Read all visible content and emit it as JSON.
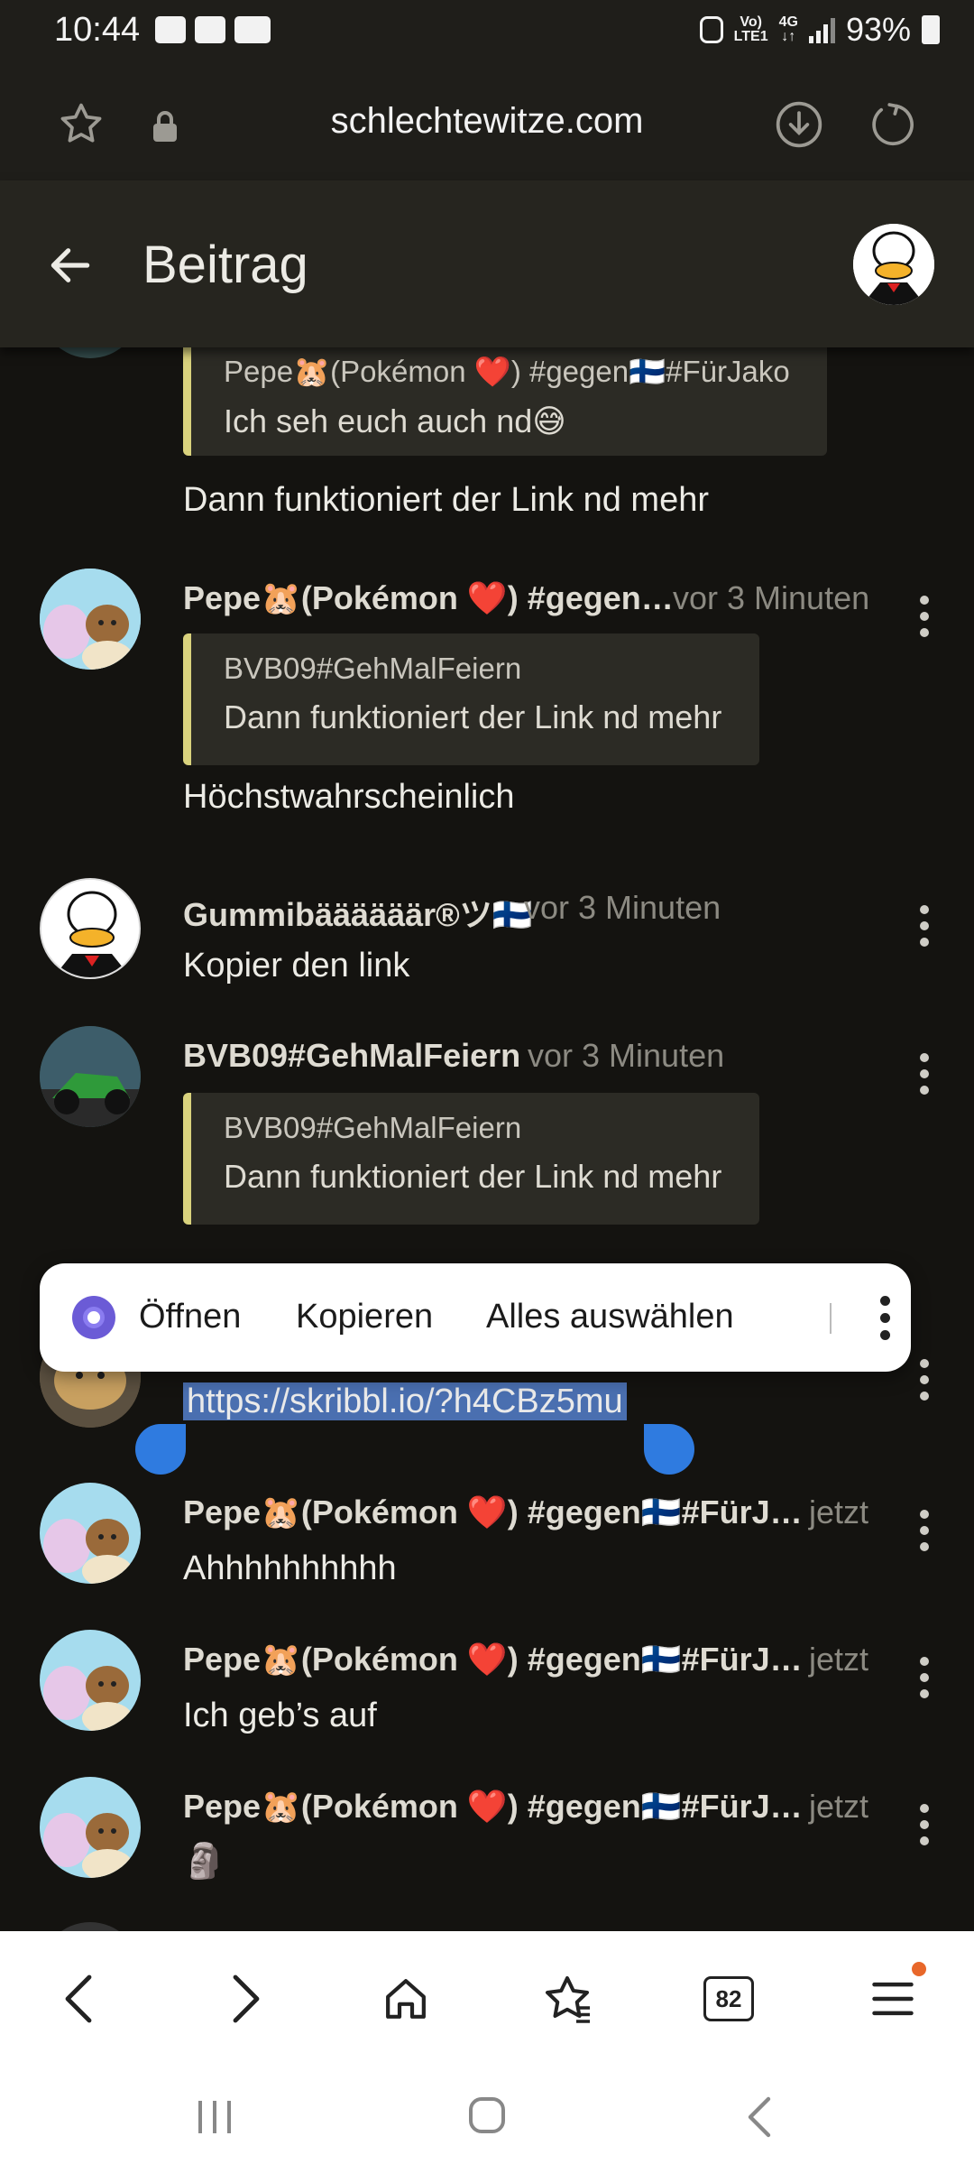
{
  "status_bar": {
    "time": "10:44",
    "network_top": "Vo)",
    "network_bottom": "LTE1",
    "network_gen": "4G",
    "battery": "93%"
  },
  "url_bar": {
    "domain": "schlechtewitze.com",
    "icons": [
      "star-outline-icon",
      "lock-icon",
      "download-icon",
      "reload-icon"
    ]
  },
  "header": {
    "title": "Beitrag"
  },
  "feed": {
    "partial": {
      "quote_author": "Pepe🐹(Pokémon ❤️) #gegen🇫🇮#FürJako",
      "quote_text": "Ich seh euch auch nd😅",
      "message": "Dann funktioniert der Link nd mehr"
    },
    "posts": [
      {
        "author": "Pepe🐹(Pokémon ❤️) #gegen…",
        "time": "vor 3 Minuten",
        "quote_author": "BVB09#GehMalFeiern",
        "quote_text": "Dann funktioniert der Link nd mehr",
        "message": "Höchstwahrscheinlich"
      },
      {
        "author": "Gummibäääääär®ツ🇫🇮",
        "time": "vor 3 Minuten",
        "message": "Kopier den link"
      },
      {
        "author": "BVB09#GehMalFeiern",
        "time": "vor 3 Minuten",
        "quote_author": "BVB09#GehMalFeiern",
        "quote_text": "Dann funktioniert der Link nd mehr"
      },
      {
        "author": "",
        "message": "https://skribbl.io/?h4CBz5mu"
      },
      {
        "author": "Pepe🐹(Pokémon ❤️) #gegen🇫🇮#FürJ…",
        "time": "jetzt",
        "message": "Ahhhhhhhhhh"
      },
      {
        "author": "Pepe🐹(Pokémon ❤️) #gegen🇫🇮#FürJ…",
        "time": "jetzt",
        "message": "Ich geb’s auf"
      },
      {
        "author": "Pepe🐹(Pokémon ❤️) #gegen🇫🇮#FürJ…",
        "time": "jetzt",
        "message": "🗿"
      }
    ]
  },
  "context_menu": {
    "open": "Öffnen",
    "copy": "Kopieren",
    "select_all": "Alles auswählen"
  },
  "toolbar": {
    "tab_count": "82"
  },
  "colors": {
    "background": "#141310",
    "quote_bar": "#d9d27d",
    "selection": "#4a6fb0",
    "handle": "#2f7be0",
    "notification_dot": "#e8672a"
  }
}
